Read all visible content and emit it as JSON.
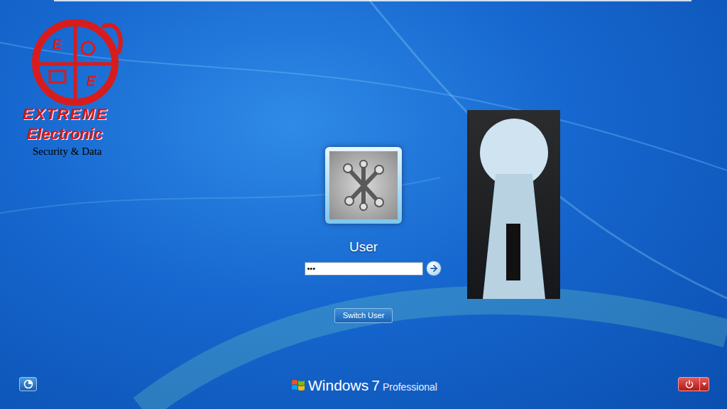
{
  "logo": {
    "letters": [
      "E",
      "E"
    ],
    "brand": "EXTREME",
    "sub": "Electronic",
    "tagline": "Security & Data"
  },
  "user": {
    "name": "User"
  },
  "password": {
    "value": "•••"
  },
  "switch_button": "Switch User",
  "branding": {
    "windows": "Windows",
    "version": "7",
    "edition": "Professional"
  }
}
